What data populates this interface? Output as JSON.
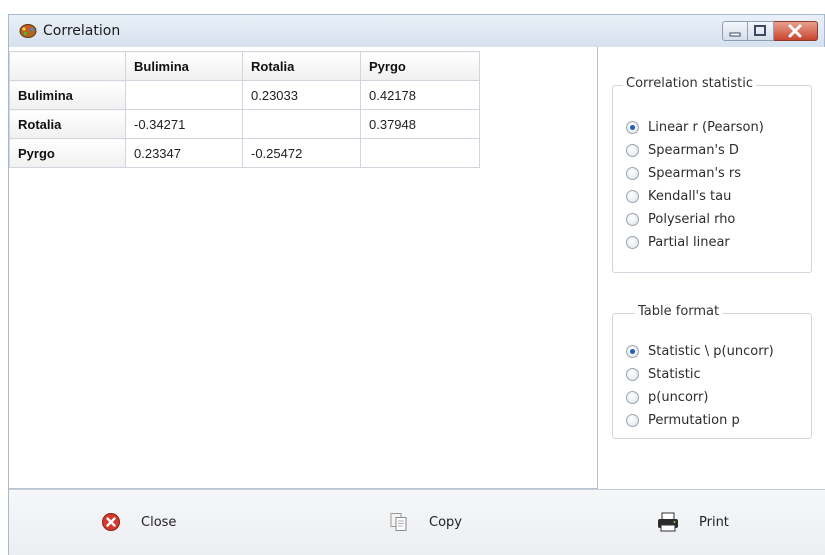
{
  "window": {
    "title": "Correlation"
  },
  "table": {
    "columns": [
      "Bulimina",
      "Rotalia",
      "Pyrgo"
    ],
    "rows": [
      {
        "label": "Bulimina",
        "cells": [
          "",
          "0.23033",
          "0.42178"
        ]
      },
      {
        "label": "Rotalia",
        "cells": [
          "-0.34271",
          "",
          "0.37948"
        ]
      },
      {
        "label": "Pyrgo",
        "cells": [
          "0.23347",
          "-0.25472",
          ""
        ]
      }
    ]
  },
  "correlation_statistic": {
    "title": "Correlation statistic",
    "options": [
      {
        "label": "Linear r (Pearson)",
        "selected": true
      },
      {
        "label": "Spearman's D",
        "selected": false
      },
      {
        "label": "Spearman's rs",
        "selected": false
      },
      {
        "label": "Kendall's tau",
        "selected": false
      },
      {
        "label": "Polyserial rho",
        "selected": false
      },
      {
        "label": "Partial linear",
        "selected": false
      }
    ]
  },
  "table_format": {
    "title": "Table format",
    "options": [
      {
        "label": "Statistic \\ p(uncorr)",
        "selected": true
      },
      {
        "label": "Statistic",
        "selected": false
      },
      {
        "label": "p(uncorr)",
        "selected": false
      },
      {
        "label": "Permutation p",
        "selected": false
      }
    ]
  },
  "actions": {
    "close_label": "Close",
    "copy_label": "Copy",
    "print_label": "Print"
  },
  "icons": {
    "app": "palette-icon",
    "close": "close-circle-icon",
    "copy": "copy-icon",
    "print": "printer-icon"
  },
  "colors": {
    "radio_selected": "#1e5ec8",
    "close_button": "#c9452f",
    "close_icon": "#d23a2e"
  }
}
